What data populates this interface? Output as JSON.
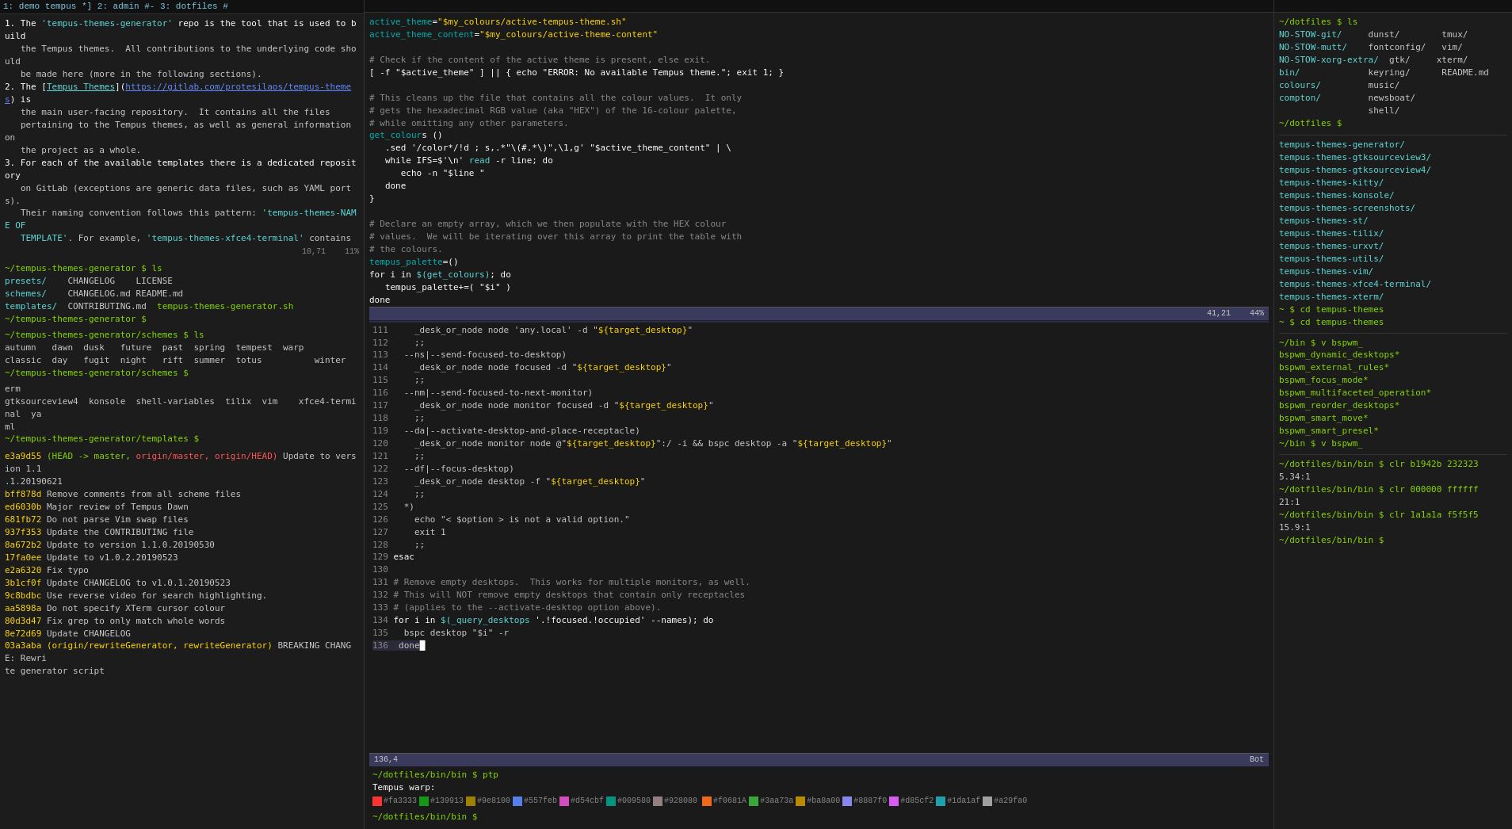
{
  "tabbar": {
    "tabs": "1: demo tempus *] 2: admin #-  3: dotfiles #"
  },
  "pane_left": {
    "section1": {
      "lines": [
        {
          "num": "1.",
          "parts": [
            {
              "t": "The ",
              "c": ""
            },
            {
              "t": "'tempus-themes-generator'",
              "c": "c-cyan"
            },
            {
              "t": " repo is the tool that is used to build",
              "c": ""
            }
          ]
        },
        {
          "text": "   the Tempus themes.  All contributions to the underlying code should",
          "c": ""
        },
        {
          "text": "   be made here (more in the following sections).",
          "c": ""
        },
        {
          "num": "2.",
          "parts": [
            {
              "t": "The [",
              "c": ""
            },
            {
              "t": "Tempus Themes",
              "c": "c-cyan underline"
            },
            {
              "t": "](",
              "c": ""
            },
            {
              "t": "https://gitlab.com/protesilaos/tempus-themes",
              "c": "c-blue underline"
            },
            {
              "t": ") is",
              "c": ""
            }
          ]
        },
        {
          "text": "   the main user-facing repository.  It contains all the files",
          "c": ""
        },
        {
          "text": "   pertaining to the Tempus themes, as well as general information on",
          "c": ""
        },
        {
          "text": "   the project as a whole.",
          "c": ""
        },
        {
          "num": "3.",
          "parts": [
            {
              "t": "For each of the available templates there is a dedicated repository",
              "c": ""
            }
          ]
        },
        {
          "text": "   on GitLab (exceptions are generic data files, such as YAML ports).",
          "c": ""
        },
        {
          "text": "   Their naming convention follows this pattern: ",
          "c": ""
        },
        {
          "parts": [
            {
              "t": "   ",
              "c": ""
            },
            {
              "t": "'tempus-themes-NAME OF",
              "c": "c-cyan"
            },
            {
              "t": "   ",
              "c": ""
            },
            {
              "t": "TEMPLATE'",
              "c": "c-cyan"
            },
            {
              "t": ". For example, ",
              "c": ""
            },
            {
              "t": "'tempus-themes-xfce4-terminal'",
              "c": "c-cyan"
            },
            {
              "t": " contains",
              "c": ""
            }
          ]
        }
      ],
      "position": "10,71",
      "percent": "11%"
    },
    "ls_output": {
      "prompt": "~/tempus-themes-generator $ ls",
      "items": [
        {
          "name": "presets/",
          "c": "c-cyan"
        },
        {
          "name": "CHANGELOG",
          "c": ""
        },
        {
          "name": "LICENSE",
          "c": ""
        },
        {
          "name": "schemes/",
          "c": "c-cyan"
        },
        {
          "name": "CHANGELOG.md",
          "c": ""
        },
        {
          "name": "README.md",
          "c": ""
        },
        {
          "name": "templates/",
          "c": "c-cyan"
        },
        {
          "name": "CONTRIBUTING.md",
          "c": ""
        },
        {
          "name": "tempus-themes-generator.sh",
          "c": "c-green"
        }
      ],
      "prompt2": "~/tempus-themes-generator $"
    },
    "git_log": {
      "prompt": "~/tempus-themes-generator $ ls",
      "schemes": "autumn   dawn  dusk   future  past  spring  summer  tempest  warp",
      "schemes2": "classic  day   fugit  night   rift   summer  totus          winter",
      "prompt2": "~/tempus-themes-generator/schemes $",
      "templates_prompt": "~/tempus-themes-generator/templates $",
      "template_items": "erm\ngtksourceview4  konsole  shell-variables  tilix  vim    xfce4-terminal  ya\nml",
      "commit_lines": [
        {
          "hash": "e3a9d55",
          "head": "(HEAD -> master,",
          "c_head": "c-green",
          "refs": " origin/master,",
          "c_refs": "c-red",
          "refs2": " origin/HEAD)",
          "c_refs2": "c-red",
          "msg": " Update to version 1.1.1.20190621"
        },
        {
          "hash": "bff878d",
          "msg": " Remove comments from all scheme files"
        },
        {
          "hash": "ed6030b",
          "msg": " Major review of Tempus Dawn"
        },
        {
          "hash": "681fb72",
          "msg": " Do not parse Vim swap files"
        },
        {
          "hash": "937f353",
          "msg": " Update the CONTRIBUTING file"
        },
        {
          "hash": "8a672b2",
          "msg": " Update to version 1.1.0.20190530"
        },
        {
          "hash": "17fa0ee",
          "msg": " Update to v1.0.2.20190523"
        },
        {
          "hash": "e2a6320",
          "msg": " Fix typo"
        },
        {
          "hash": "3b1cf0f",
          "msg": " Update CHANGELOG to v1.0.1.20190523"
        },
        {
          "hash": "9c8bdbc",
          "msg": " Use reverse video for search highlighting."
        },
        {
          "hash": "aa5898a",
          "msg": " Do not specify XTerm cursor colour"
        },
        {
          "hash": "80d3d47",
          "msg": " Fix grep to only match whole words"
        },
        {
          "hash": "8e72d69",
          "msg": " Update CHANGELOG"
        },
        {
          "hash": "03a3aba",
          "ref1": "(origin/rewriteGenerator,",
          "c1": "c-yellow",
          "ref2": " rewriteGenerator)",
          "c2": "c-yellow",
          "msg": " BREAKING CHANGE: Rewri"
        },
        {
          "text": "te generator script"
        }
      ]
    }
  },
  "pane_middle": {
    "top_section": {
      "code": [
        {
          "t": "active_theme=",
          "c": "c-white"
        },
        {
          "t": "\"$my_colours/active-tempus-theme.sh\"",
          "c": "c-yellow"
        },
        {
          "t": "",
          "c": ""
        },
        {
          "t": "active_theme_content=",
          "c": "c-white"
        },
        {
          "t": "\"$my_colours/active-theme-content\"",
          "c": "c-yellow"
        },
        "",
        {
          "t": "# Check if the content of the active theme is present, else exit.",
          "c": "c-gray"
        },
        {
          "t": "[ -f \"$active_theme\" ] || { echo \"ERROR: No available Tempus theme.\"; exit 1; }",
          "c": "c-white"
        },
        "",
        {
          "t": "# This cleans up the file that contains all the colour values.  It only",
          "c": "c-gray"
        },
        {
          "t": "# gets the hexadecimal RGB value (aka \"HEX\") of the 16-colour palette,",
          "c": "c-gray"
        },
        {
          "t": "# while omitting any other parameters.",
          "c": "c-gray"
        },
        {
          "t": "get_colours ()",
          "c": "c-white"
        },
        {
          "t": "   .sed '/color*/!d ; s,.*\"\\(#.*\\)\",\\1,g' \"$active_theme_content\" | \\",
          "c": "c-white"
        },
        {
          "t": "   while IFS=$'\\n' ",
          "c": "c-white"
        },
        {
          "t": "read",
          "c": "c-cyan"
        },
        {
          "t": " -r line; do",
          "c": "c-white"
        },
        {
          "t": "      echo -n \"$line \"",
          "c": "c-white"
        },
        {
          "t": "   done",
          "c": "c-white"
        },
        {
          "t": "}",
          "c": "c-white"
        },
        "",
        {
          "t": "# Declare an empty array, which we then populate with the HEX colour",
          "c": "c-gray"
        },
        {
          "t": "# values.  We will be iterating over this array to print the table with",
          "c": "c-gray"
        },
        {
          "t": "# the colours.",
          "c": "c-gray"
        },
        {
          "t": "tempus_palette=()",
          "c": "c-white"
        },
        {
          "t": "for i in ",
          "c": "c-white"
        },
        {
          "t": "$(get_colours)",
          "c": "c-cyan"
        },
        {
          "t": "; do",
          "c": "c-white"
        },
        {
          "t": "   tempus_palette+=( \"$i\" )",
          "c": "c-white"
        },
        {
          "t": "done",
          "c": "c-white"
        }
      ],
      "status": "41,21    44%"
    },
    "bottom_section": {
      "lines": [
        {
          "num": "111",
          "code": "    _desk_or_node node 'any.local' -d \"${target_desktop}\""
        },
        {
          "num": "112",
          "code": "    ;;"
        },
        {
          "num": "113",
          "code": "  --ns|--send-focused-to-desktop)"
        },
        {
          "num": "114",
          "code": "    _desk_or_node node focused -d \"${target_desktop}\""
        },
        {
          "num": "115",
          "code": "    ;;"
        },
        {
          "num": "116",
          "code": "  --nm|--send-focused-to-next-monitor)"
        },
        {
          "num": "117",
          "code": "    _desk_or_node node monitor focused -d \"${target_desktop}\""
        },
        {
          "num": "118",
          "code": "    ;;"
        },
        {
          "num": "119",
          "code": "  --da|--activate-desktop-and-place-receptacle)"
        },
        {
          "num": "120",
          "code": "    _desk_or_node monitor node @\"${target_desktop}\":/ -i && bspc desktop -a \"${target_desktop}\""
        },
        {
          "num": "121",
          "code": "    ;;"
        },
        {
          "num": "122",
          "code": "  --df|--focus-desktop)"
        },
        {
          "num": "123",
          "code": "    _desk_or_node desktop -f \"${target_desktop}\""
        },
        {
          "num": "124",
          "code": "    ;;"
        },
        {
          "num": "125",
          "code": "  *)"
        },
        {
          "num": "126",
          "code": "    echo \"< $option > is not a valid option.\""
        },
        {
          "num": "127",
          "code": "    exit 1"
        },
        {
          "num": "128",
          "code": "    ;;"
        },
        {
          "num": "129",
          "code": "esac"
        },
        {
          "num": "130",
          "code": ""
        },
        {
          "num": "131",
          "code": "# Remove empty desktops.  This works for multiple monitors, as well."
        },
        {
          "num": "132",
          "code": "# This will NOT remove empty desktops that contain only receptacles"
        },
        {
          "num": "133",
          "code": "# (applies to the --activate-desktop option above)."
        },
        {
          "num": "134",
          "code": "for i in $(\\`_query_desktops\\` '.!focused.!occupied' --names); do"
        },
        {
          "num": "135",
          "code": "  bspc desktop \"$i\" -r"
        },
        {
          "num": "136",
          "code": "done"
        }
      ],
      "status_left": "136,4",
      "status_right": "Bot"
    },
    "bottom_prompt": {
      "lines": [
        "~/dotfiles/bin/bin $ ptp",
        "Tempus warp:"
      ],
      "colors": [
        {
          "hex": "#fa3333",
          "color": "#fa3333"
        },
        {
          "hex": "#139913",
          "color": "#139913"
        },
        {
          "hex": "#9e8100",
          "color": "#9e8100"
        },
        {
          "hex": "#557feb",
          "color": "#557feb"
        },
        {
          "hex": "#d54cbf",
          "color": "#d54cbf"
        },
        {
          "hex": "#009580",
          "color": "#009580"
        },
        {
          "hex": "#928080",
          "color": "#928080"
        },
        {
          "hex": "#f0681A",
          "color": "#f0681A"
        },
        {
          "hex": "#3aa73a",
          "color": "#3aa73a"
        },
        {
          "hex": "#ba8a00",
          "color": "#ba8a00"
        },
        {
          "hex": "#8887f0",
          "color": "#8887f0"
        },
        {
          "hex": "#d85cf2",
          "color": "#d85cf2"
        },
        {
          "hex": "#1da1af",
          "color": "#1da1af"
        },
        {
          "hex": "#a29fa0",
          "color": "#a29fa0"
        }
      ],
      "final_prompt": "~/dotfiles/bin/bin $"
    }
  },
  "pane_right": {
    "section1": {
      "prompt": "~/dotfiles $ ls",
      "items_col1": [
        "NO-STOW-git/",
        "NO-STOW-mutt/",
        "NO-STOW-xorg-extra/",
        "bin/",
        "colours/",
        "compton/",
        "~/dotfiles $"
      ],
      "items_col2": [
        "dunst/",
        "fontconfig/",
        "gtk/",
        "keyring/",
        "music/",
        "newsboat/",
        "shell/"
      ],
      "items_col3": [
        "tmux/",
        "vim/",
        "xterm/",
        ""
      ],
      "readme": "README.md"
    },
    "tempus_section": {
      "prompt": "tempus-themes-generator $",
      "label": "tempus themes",
      "items": [
        "tempus-themes-generator/",
        "tempus-themes-gtksourceview3/",
        "tempus-themes-gtksourceview4/",
        "tempus-themes-kitty/",
        "tempus-themes-konsole/",
        "tempus-themes-screenshots/",
        "tempus-themes-st/",
        "tempus-themes-tilix/",
        "tempus-themes-urxvt/",
        "tempus-themes-utils/",
        "tempus-themes-vim/",
        "tempus-themes-xfce4-terminal/",
        "tempus-themes-xterm/"
      ],
      "cd_lines": [
        "~ $ cd tempus-themes",
        "~ $ cd tempus-themes"
      ]
    },
    "bspwm_section": {
      "prompt": "~/bin $ v bspwm_",
      "items": [
        "bspwm_dynamic_desktops*",
        "bspwm_external_rules*",
        "bspwm_focus_mode*",
        "bspwm_multifaceted_operation*",
        "bspwm_reorder_desktops*",
        "bspwm_smart_move*",
        "bspwm_smart_presel*"
      ],
      "prompt2": "~/bin $ v bspwm_"
    },
    "clr_section": {
      "lines": [
        "~/dotfiles/bin/bin $ clr b1942b 232323",
        "5.34:1",
        "~/dotfiles/bin/bin $ clr 000000 ffffff",
        "21:1",
        "~/dotfiles/bin/bin $ clr 1a1a1a f5f5f5",
        "15.9:1",
        "~/dotfiles/bin/bin $"
      ]
    }
  }
}
